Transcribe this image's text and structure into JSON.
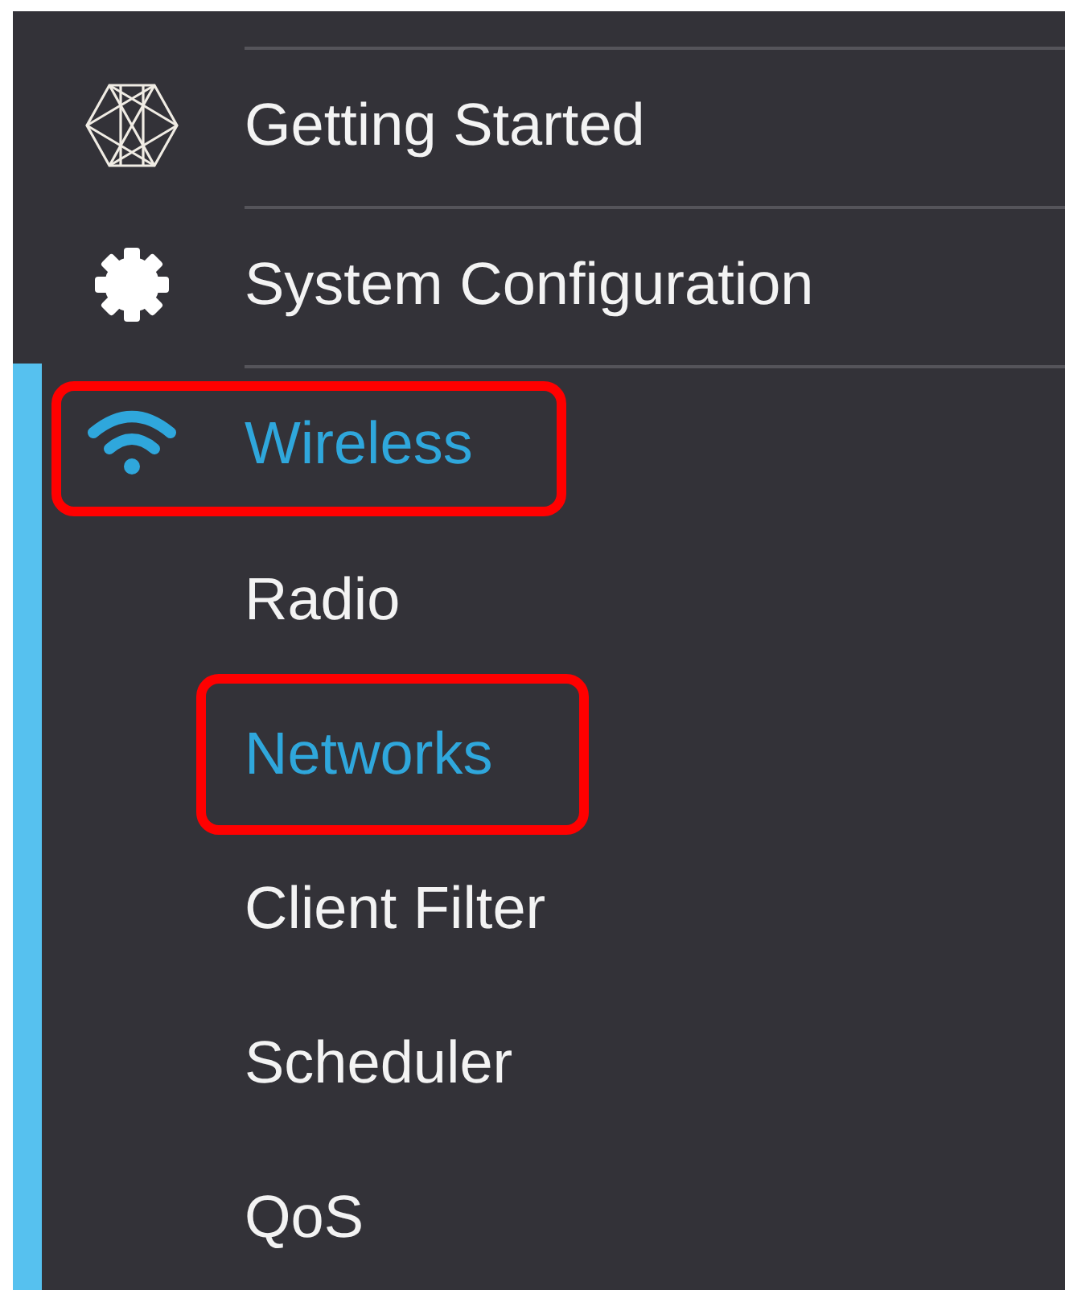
{
  "menu": {
    "items": [
      {
        "label": "Getting Started",
        "selected": false,
        "expanded": false,
        "highlighted": false
      },
      {
        "label": "System Configuration",
        "selected": false,
        "expanded": false,
        "highlighted": false
      },
      {
        "label": "Wireless",
        "selected": true,
        "expanded": true,
        "highlighted": true,
        "children": [
          {
            "label": "Radio",
            "selected": false,
            "highlighted": false
          },
          {
            "label": "Networks",
            "selected": true,
            "highlighted": true
          },
          {
            "label": "Client Filter",
            "selected": false,
            "highlighted": false
          },
          {
            "label": "Scheduler",
            "selected": false,
            "highlighted": false
          },
          {
            "label": "QoS",
            "selected": false,
            "highlighted": false
          }
        ]
      }
    ]
  }
}
